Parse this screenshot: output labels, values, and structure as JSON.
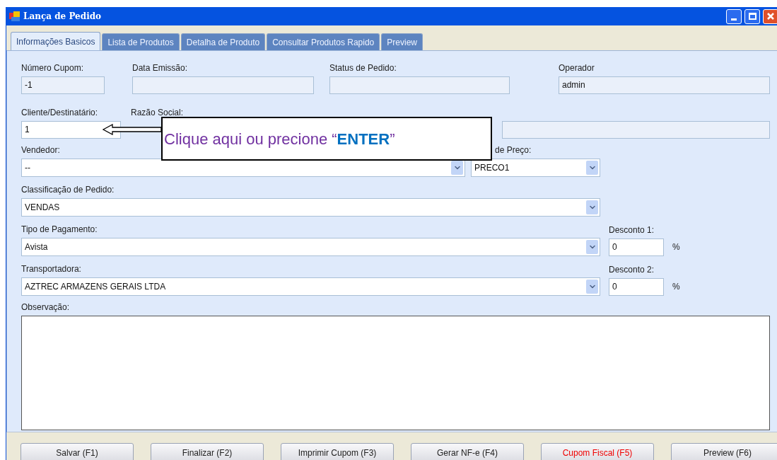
{
  "window": {
    "title": "Lança de Pedido"
  },
  "tabs": [
    {
      "label": "Informações Basicos",
      "selected": true
    },
    {
      "label": "Lista de Produtos",
      "selected": false
    },
    {
      "label": "Detalha de Produto",
      "selected": false
    },
    {
      "label": "Consultar Produtos Rapido",
      "selected": false
    },
    {
      "label": "Preview",
      "selected": false
    }
  ],
  "row1": [
    {
      "label": "Número Cupom:",
      "value": "-1"
    },
    {
      "label": "Data Emissão:"
    },
    {
      "label": "Status de Pedido:"
    },
    {
      "label": "Operador",
      "value": "admin"
    }
  ],
  "cliente": {
    "label": "Cliente/Destinatário:",
    "value": "1"
  },
  "razao_social": {
    "label": "Razão Social:"
  },
  "vendedor": {
    "label": "Vendedor:",
    "value": "--"
  },
  "tabela_preco": {
    "label": "de Preço:",
    "value": "PRECO1"
  },
  "classificacao": {
    "label": "Classificação de Pedido:",
    "value": "VENDAS"
  },
  "pagamento": {
    "label": "Tipo de Pagamento:",
    "value": "Avista"
  },
  "desconto_1": {
    "label": "Desconto 1:",
    "value": "0",
    "unit": "%"
  },
  "transportadora": {
    "label": "Transportadora:",
    "value": "AZTREC ARMAZENS GERAIS LTDA"
  },
  "desconto_2": {
    "label": "Desconto 2:",
    "value": "0",
    "unit": "%"
  },
  "observacao": {
    "label": "Observação:"
  },
  "callout": {
    "text": "Clique aqui ou precione “**ENTER**”"
  },
  "buttons": [
    {
      "label": "Salvar (F1)",
      "alert": false
    },
    {
      "label": "Finalizar (F2)",
      "alert": false
    },
    {
      "label": "Imprimir Cupom (F3)",
      "alert": false
    },
    {
      "label": "Gerar NF-e (F4)",
      "alert": false
    },
    {
      "label": "Cupom Fiscal (F5)",
      "alert": true
    },
    {
      "label": "Preview (F6)",
      "alert": false
    }
  ]
}
